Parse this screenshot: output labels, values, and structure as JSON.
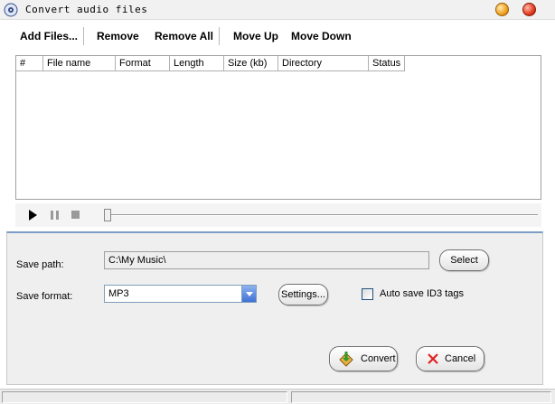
{
  "window": {
    "title": "Convert audio files"
  },
  "toolbar": {
    "add_files": "Add Files...",
    "remove": "Remove",
    "remove_all": "Remove All",
    "move_up": "Move Up",
    "move_down": "Move Down"
  },
  "file_list": {
    "columns": [
      "#",
      "File name",
      "Format",
      "Length",
      "Size (kb)",
      "Directory",
      "Status"
    ],
    "rows": []
  },
  "player": {
    "icons": [
      "play-icon",
      "pause-icon",
      "stop-icon"
    ],
    "position": 0
  },
  "settings": {
    "save_path_label": "Save path:",
    "save_path_value": "C:\\My Music\\",
    "select_button": "Select",
    "save_format_label": "Save format:",
    "save_format_value": "MP3",
    "settings_button": "Settings...",
    "auto_id3_label": "Auto save ID3 tags",
    "auto_id3_checked": false,
    "convert_button": "Convert",
    "cancel_button": "Cancel"
  },
  "colors": {
    "panel_accent": "#7a9ec6",
    "cancel_icon": "#e02020",
    "convert_icon": "#2e9a2e"
  }
}
